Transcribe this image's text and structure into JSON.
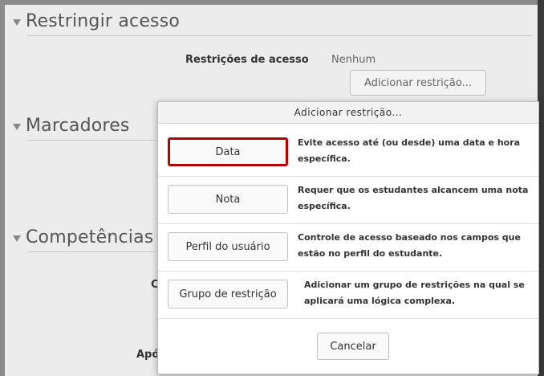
{
  "sections": {
    "restrict": "Restringir acesso",
    "tags": "Marcadores",
    "competencies": "Competências"
  },
  "restrict_access": {
    "label": "Restrições de acesso",
    "value": "Nenhum",
    "add_button": "Adicionar restrição..."
  },
  "partial_labels": {
    "c": "C",
    "apo": "Apó"
  },
  "dialog": {
    "title": "Adicionar restrição...",
    "options": [
      {
        "label": "Data",
        "description_line1": "Evite acesso até (ou desde) uma data e hora",
        "description_line2": "específica."
      },
      {
        "label": "Nota",
        "description_line1": "Requer que os estudantes alcancem uma nota",
        "description_line2": "específica."
      },
      {
        "label": "Perfil do usuário",
        "description_line1": "Controle de acesso baseado nos campos que",
        "description_line2": "estão no perfil do estudante."
      },
      {
        "label": "Grupo de restrição",
        "description_line1": "Adicionar um grupo de restrições na qual se",
        "description_line2": "aplicará uma lógica complexa."
      }
    ],
    "cancel": "Cancelar"
  },
  "colors": {
    "highlight": "#b20000"
  }
}
